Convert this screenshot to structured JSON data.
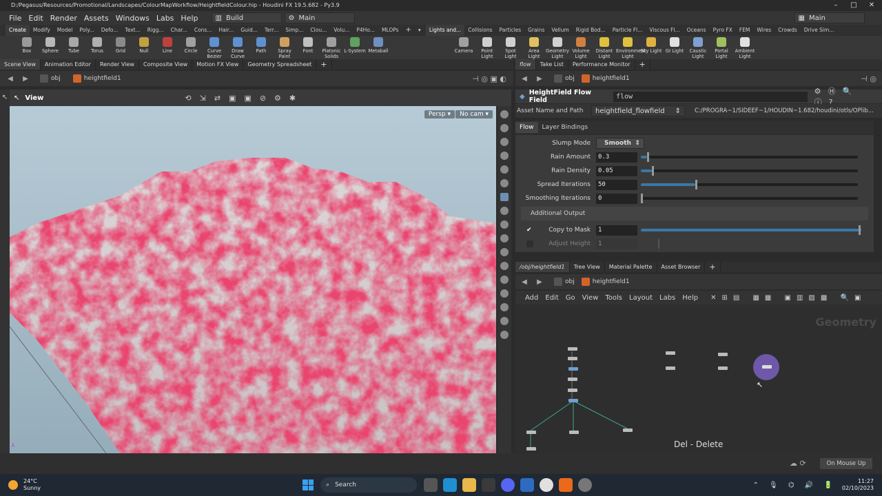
{
  "window": {
    "title": "D:/Pegasus/Resources/Promotional/Landscapes/ColourMapWorkflow/HeightfieldColour.hip - Houdini FX 19.5.682 - Py3.9",
    "controls": [
      "minimize",
      "maximize",
      "close"
    ]
  },
  "menubar": {
    "items": [
      "File",
      "Edit",
      "Render",
      "Assets",
      "Windows",
      "Labs",
      "Help"
    ],
    "desktop": "Build",
    "network": "Main",
    "right_desktop": "Main"
  },
  "shelf_tabs_left": [
    "Create",
    "Modify",
    "Model",
    "Poly...",
    "Defo...",
    "Text...",
    "Rigg...",
    "Char...",
    "Cons...",
    "Hair...",
    "Guid...",
    "Terr...",
    "Simp...",
    "Clou...",
    "Volu...",
    "P4Ho...",
    "MLOPs"
  ],
  "shelf_tabs_right": [
    "Lights and...",
    "Collisions",
    "Particles",
    "Grains",
    "Vellum",
    "Rigid Bod...",
    "Particle Fl...",
    "Viscous Fl...",
    "Oceans",
    "Pyro FX",
    "FEM",
    "Wires",
    "Crowds",
    "Drive Sim..."
  ],
  "tools_left": [
    {
      "label": "Box",
      "icon": "box-icon",
      "color": "#9a9a9a"
    },
    {
      "label": "Sphere",
      "icon": "sphere-icon",
      "color": "#b8b8b8"
    },
    {
      "label": "Tube",
      "icon": "tube-icon",
      "color": "#a8a8a8"
    },
    {
      "label": "Torus",
      "icon": "torus-icon",
      "color": "#b0b0b0"
    },
    {
      "label": "Grid",
      "icon": "grid-icon",
      "color": "#8a8a8a"
    },
    {
      "label": "Null",
      "icon": "null-icon",
      "color": "#c0a040"
    },
    {
      "label": "Line",
      "icon": "line-icon",
      "color": "#c04040"
    },
    {
      "label": "Circle",
      "icon": "circle-icon",
      "color": "#a0a0a0"
    },
    {
      "label": "Curve Bezier",
      "icon": "curve-bezier-icon",
      "color": "#6090d0"
    },
    {
      "label": "Draw Curve",
      "icon": "draw-curve-icon",
      "color": "#6090d0"
    },
    {
      "label": "Path",
      "icon": "path-icon",
      "color": "#6090d0"
    },
    {
      "label": "Spray Paint",
      "icon": "spray-paint-icon",
      "color": "#d0a060"
    },
    {
      "label": "Font",
      "icon": "font-icon",
      "color": "#c0c0c0"
    },
    {
      "label": "Platonic Solids",
      "icon": "platonic-icon",
      "color": "#a0a0a0"
    },
    {
      "label": "L-System",
      "icon": "lsystem-icon",
      "color": "#60a060"
    },
    {
      "label": "Metaball",
      "icon": "metaball-icon",
      "color": "#7090c0"
    }
  ],
  "tools_right": [
    {
      "label": "Camera",
      "icon": "camera-icon",
      "color": "#a0a0a0"
    },
    {
      "label": "Point Light",
      "icon": "point-light-icon",
      "color": "#d0d0d0"
    },
    {
      "label": "Spot Light",
      "icon": "spot-light-icon",
      "color": "#d0d0d0"
    },
    {
      "label": "Area Light",
      "icon": "area-light-icon",
      "color": "#e0c060"
    },
    {
      "label": "Geometry Light",
      "icon": "geometry-light-icon",
      "color": "#d0d0d0"
    },
    {
      "label": "Volume Light",
      "icon": "volume-light-icon",
      "color": "#d08040"
    },
    {
      "label": "Distant Light",
      "icon": "distant-light-icon",
      "color": "#e0c040"
    },
    {
      "label": "Environment Light",
      "icon": "environment-light-icon",
      "color": "#e0c040"
    },
    {
      "label": "Sky Light",
      "icon": "sky-light-icon",
      "color": "#e0b040"
    },
    {
      "label": "GI Light",
      "icon": "gi-light-icon",
      "color": "#e0e0e0"
    },
    {
      "label": "Caustic Light",
      "icon": "caustic-light-icon",
      "color": "#80a0d0"
    },
    {
      "label": "Portal Light",
      "icon": "portal-light-icon",
      "color": "#a0c060"
    },
    {
      "label": "Ambient Light",
      "icon": "ambient-light-icon",
      "color": "#e0e0e0"
    }
  ],
  "left_tabs": [
    "Scene View",
    "Animation Editor",
    "Render View",
    "Composite View",
    "Motion FX View",
    "Geometry Spreadsheet"
  ],
  "path": {
    "context": "obj",
    "node": "heightfield1"
  },
  "viewport": {
    "title": "View",
    "persp": "Persp",
    "cam": "No cam"
  },
  "right_top_tabs": [
    "flow",
    "Take List",
    "Performance Monitor"
  ],
  "params": {
    "node_type": "HeightField Flow Field",
    "node_name": "flow",
    "asset_label": "Asset Name and Path",
    "asset_name": "heightfield_flowfield",
    "asset_path": "C:/PROGRA~1/SIDEEF~1/HOUDIN~1.682/houdini/otls/OPlib...",
    "tabs": [
      "Flow",
      "Layer Bindings"
    ],
    "slump_label": "Slump Mode",
    "slump_value": "Smooth",
    "rows": [
      {
        "label": "Rain Amount",
        "value": "0.3",
        "fraction": 0.03
      },
      {
        "label": "Rain Density",
        "value": "0.05",
        "fraction": 0.05
      },
      {
        "label": "Spread Iterations",
        "value": "50",
        "fraction": 0.25
      },
      {
        "label": "Smoothing Iterations",
        "value": "0",
        "fraction": 0.0
      }
    ],
    "section": "Additional Output",
    "copy_label": "Copy to Mask",
    "copy_value": "1",
    "adjust_label": "Adjust Height",
    "adjust_value": "1"
  },
  "net_tabs": [
    "/obj/heightfield1",
    "Tree View",
    "Material Palette",
    "Asset Browser"
  ],
  "net_menu": [
    "Add",
    "Edit",
    "Go",
    "View",
    "Tools",
    "Layout",
    "Labs",
    "Help"
  ],
  "net_watermark": "Geometry",
  "hotkey_hint": "Del - Delete",
  "status": {
    "update_mode": "On Mouse Up"
  },
  "taskbar": {
    "weather_temp": "24°C",
    "weather_desc": "Sunny",
    "search": "Search",
    "time": "11:27",
    "date": "02/10/2023"
  }
}
